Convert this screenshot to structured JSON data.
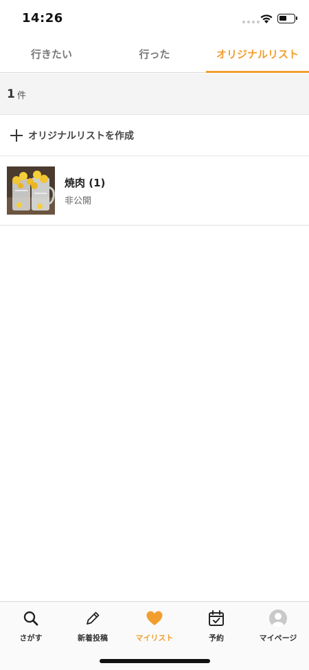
{
  "status_bar": {
    "time": "14:26"
  },
  "tabs": [
    {
      "label": "行きたい",
      "active": false
    },
    {
      "label": "行った",
      "active": false
    },
    {
      "label": "オリジナルリスト",
      "active": true
    }
  ],
  "count": {
    "number": "1",
    "unit": "件"
  },
  "create_list": {
    "label": "オリジナルリストを作成",
    "icon": "plus-icon"
  },
  "lists": [
    {
      "title": "焼肉 (1)",
      "visibility": "非公開"
    }
  ],
  "bottom_nav": [
    {
      "label": "さがす",
      "icon": "search-icon",
      "active": false
    },
    {
      "label": "新着投稿",
      "icon": "pencil-icon",
      "active": false
    },
    {
      "label": "マイリスト",
      "icon": "heart-icon",
      "active": true
    },
    {
      "label": "予約",
      "icon": "calendar-icon",
      "active": false
    },
    {
      "label": "マイページ",
      "icon": "avatar-icon",
      "active": false
    }
  ],
  "colors": {
    "accent": "#f29e2e",
    "text": "#222222",
    "muted": "#777777"
  }
}
